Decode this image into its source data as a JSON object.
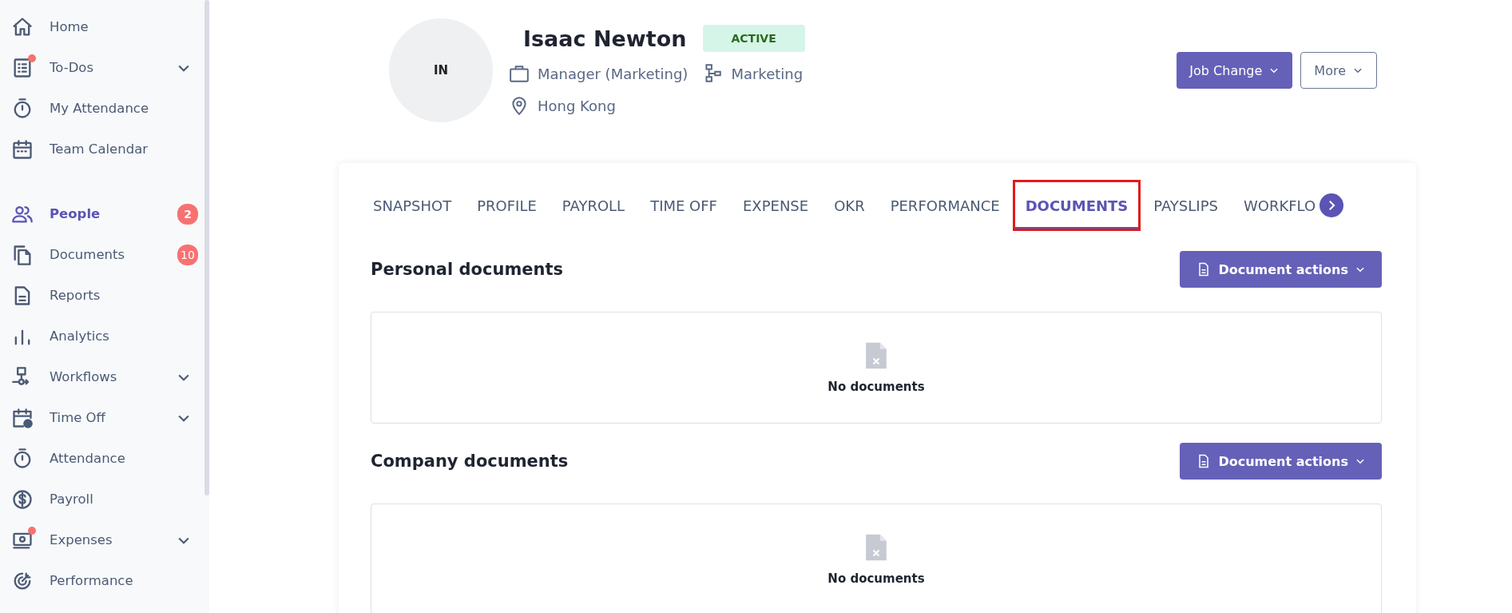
{
  "sidebar": {
    "groups": [
      [
        {
          "label": "Home",
          "selected": false,
          "alert": false,
          "has_submenu": false
        },
        {
          "label": "To-Dos",
          "selected": false,
          "alert": true,
          "has_submenu": true
        },
        {
          "label": "My Attendance",
          "selected": false,
          "alert": false,
          "has_submenu": false
        },
        {
          "label": "Team Calendar",
          "selected": false,
          "alert": false,
          "has_submenu": false
        }
      ],
      [
        {
          "label": "People",
          "selected": true,
          "alert": false,
          "has_submenu": false,
          "badge": "2"
        },
        {
          "label": "Documents",
          "selected": false,
          "alert": false,
          "has_submenu": false,
          "badge": "10"
        },
        {
          "label": "Reports",
          "selected": false,
          "alert": false,
          "has_submenu": false
        },
        {
          "label": "Analytics",
          "selected": false,
          "alert": false,
          "has_submenu": false
        },
        {
          "label": "Workflows",
          "selected": false,
          "alert": false,
          "has_submenu": true
        },
        {
          "label": "Time Off",
          "selected": false,
          "alert": false,
          "has_submenu": true
        },
        {
          "label": "Attendance",
          "selected": false,
          "alert": false,
          "has_submenu": false
        },
        {
          "label": "Payroll",
          "selected": false,
          "alert": false,
          "has_submenu": false
        },
        {
          "label": "Expenses",
          "selected": false,
          "alert": true,
          "has_submenu": true
        },
        {
          "label": "Performance",
          "selected": false,
          "alert": false,
          "has_submenu": false
        }
      ]
    ]
  },
  "profile": {
    "initials": "IN",
    "name": "Isaac Newton",
    "status": "ACTIVE",
    "job_title": "Manager (Marketing)",
    "department": "Marketing",
    "location": "Hong Kong"
  },
  "actions": [
    {
      "label": "Job Change",
      "kind": "primary"
    },
    {
      "label": "More",
      "kind": "outline"
    }
  ],
  "tabs": [
    {
      "label": "SNAPSHOT",
      "selected": false,
      "highlighted": false
    },
    {
      "label": "PROFILE",
      "selected": false,
      "highlighted": false
    },
    {
      "label": "PAYROLL",
      "selected": false,
      "highlighted": false
    },
    {
      "label": "TIME OFF",
      "selected": false,
      "highlighted": false
    },
    {
      "label": "EXPENSE",
      "selected": false,
      "highlighted": false
    },
    {
      "label": "OKR",
      "selected": false,
      "highlighted": false
    },
    {
      "label": "PERFORMANCE",
      "selected": false,
      "highlighted": false
    },
    {
      "label": "DOCUMENTS",
      "selected": true,
      "highlighted": true
    },
    {
      "label": "PAYSLIPS",
      "selected": false,
      "highlighted": false
    },
    {
      "label": "WORKFLO",
      "selected": false,
      "highlighted": false
    }
  ],
  "sections": [
    {
      "title": "Personal documents",
      "action": "Document actions",
      "empty_text": "No documents"
    },
    {
      "title": "Company documents",
      "action": "Document actions",
      "empty_text": "No documents"
    }
  ]
}
